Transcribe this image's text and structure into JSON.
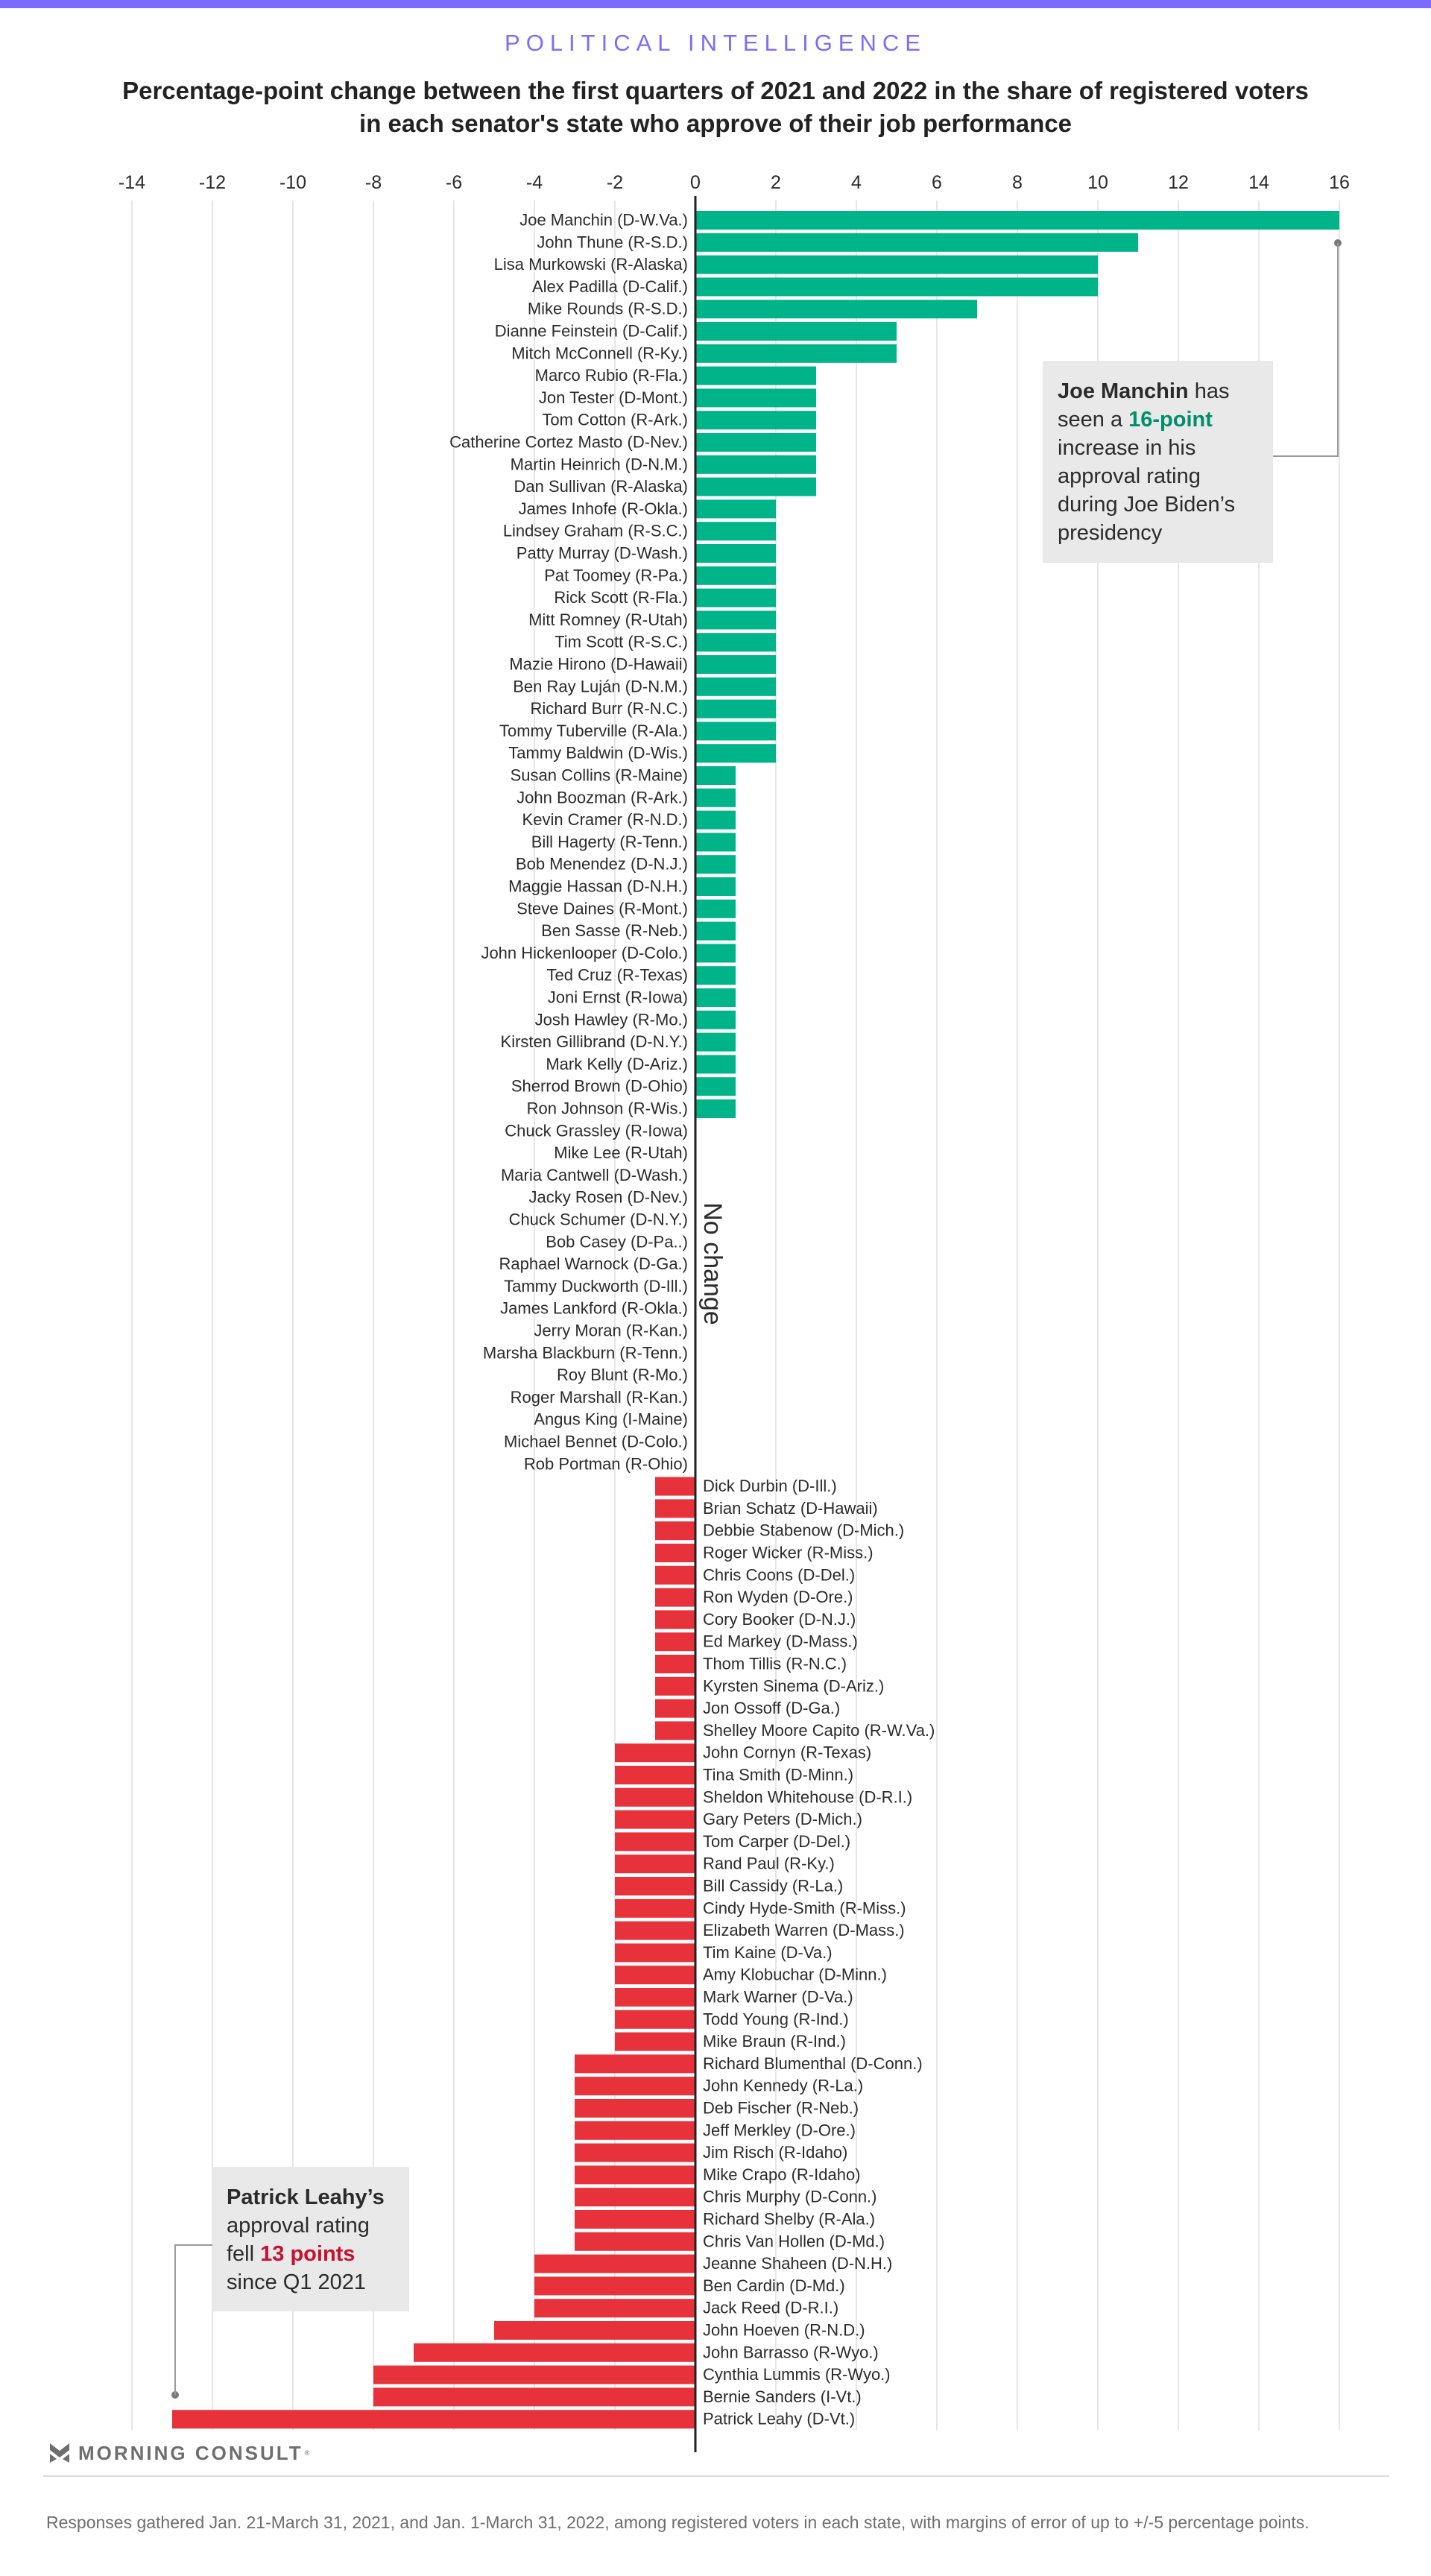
{
  "header": {
    "kicker": "POLITICAL INTELLIGENCE",
    "title": "Percentage-point change between the first quarters of 2021 and 2022 in the share of registered voters in each senator's state who approve of their job performance"
  },
  "colors": {
    "accent": "#7d6bff",
    "positive": "#00b48a",
    "negative": "#e8323b",
    "annotation_green": "#008f6b",
    "annotation_red": "#c8102e",
    "annotation_bg": "#e9e9e9"
  },
  "chart_data": {
    "type": "bar",
    "orientation": "horizontal",
    "title": "Percentage-point change between the first quarters of 2021 and 2022 in the share of registered voters in each senator's state who approve of their job performance",
    "xlabel": "",
    "ylabel": "",
    "xlim": [
      -14,
      16
    ],
    "xticks": [
      -14,
      -12,
      -10,
      -8,
      -6,
      -4,
      -2,
      0,
      2,
      4,
      6,
      8,
      10,
      12,
      14,
      16
    ],
    "xtick_labels": [
      "-14",
      "-12",
      "-10",
      "-8",
      "-6",
      "-4",
      "-2",
      "0",
      "2",
      "4",
      "6",
      "8",
      "10",
      "12",
      "14",
      "16"
    ],
    "axis_position": "top",
    "grid": true,
    "zero_label": "No change",
    "categories": [
      "Joe Manchin (D-W.Va.)",
      "John Thune (R-S.D.)",
      "Lisa Murkowski (R-Alaska)",
      "Alex Padilla (D-Calif.)",
      "Mike Rounds (R-S.D.)",
      "Dianne Feinstein (D-Calif.)",
      "Mitch McConnell (R-Ky.)",
      "Marco Rubio (R-Fla.)",
      "Jon Tester (D-Mont.)",
      "Tom Cotton (R-Ark.)",
      "Catherine Cortez Masto (D-Nev.)",
      "Martin Heinrich (D-N.M.)",
      "Dan Sullivan (R-Alaska)",
      "James Inhofe (R-Okla.)",
      "Lindsey Graham (R-S.C.)",
      "Patty Murray (D-Wash.)",
      "Pat Toomey (R-Pa.)",
      "Rick Scott (R-Fla.)",
      "Mitt Romney (R-Utah)",
      "Tim Scott (R-S.C.)",
      "Mazie Hirono (D-Hawaii)",
      "Ben Ray Luján (D-N.M.)",
      "Richard Burr (R-N.C.)",
      "Tommy Tuberville (R-Ala.)",
      "Tammy Baldwin (D-Wis.)",
      "Susan Collins (R-Maine)",
      "John Boozman (R-Ark.)",
      "Kevin Cramer (R-N.D.)",
      "Bill Hagerty (R-Tenn.)",
      "Bob Menendez (D-N.J.)",
      "Maggie Hassan (D-N.H.)",
      "Steve Daines (R-Mont.)",
      "Ben Sasse (R-Neb.)",
      "John Hickenlooper (D-Colo.)",
      "Ted Cruz (R-Texas)",
      "Joni Ernst (R-Iowa)",
      "Josh Hawley (R-Mo.)",
      "Kirsten Gillibrand (D-N.Y.)",
      "Mark Kelly (D-Ariz.)",
      "Sherrod Brown (D-Ohio)",
      "Ron Johnson (R-Wis.)",
      "Chuck Grassley (R-Iowa)",
      "Mike Lee (R-Utah)",
      "Maria Cantwell (D-Wash.)",
      "Jacky Rosen (D-Nev.)",
      "Chuck Schumer (D-N.Y.)",
      "Bob Casey (D-Pa..)",
      "Raphael Warnock (D-Ga.)",
      "Tammy Duckworth (D-Ill.)",
      "James Lankford (R-Okla.)",
      "Jerry Moran (R-Kan.)",
      "Marsha Blackburn (R-Tenn.)",
      "Roy Blunt (R-Mo.)",
      "Roger Marshall (R-Kan.)",
      "Angus King (I-Maine)",
      "Michael Bennet (D-Colo.)",
      "Rob Portman (R-Ohio)",
      "Dick Durbin (D-Ill.)",
      "Brian Schatz (D-Hawaii)",
      "Debbie Stabenow (D-Mich.)",
      "Roger Wicker (R-Miss.)",
      "Chris Coons (D-Del.)",
      "Ron Wyden (D-Ore.)",
      "Cory Booker (D-N.J.)",
      "Ed Markey (D-Mass.)",
      "Thom Tillis (R-N.C.)",
      "Kyrsten Sinema (D-Ariz.)",
      "Jon Ossoff (D-Ga.)",
      "Shelley Moore Capito (R-W.Va.)",
      "John Cornyn (R-Texas)",
      "Tina Smith (D-Minn.)",
      "Sheldon Whitehouse (D-R.I.)",
      "Gary Peters (D-Mich.)",
      "Tom Carper (D-Del.)",
      "Rand Paul (R-Ky.)",
      "Bill Cassidy (R-La.)",
      "Cindy Hyde-Smith (R-Miss.)",
      "Elizabeth Warren (D-Mass.)",
      "Tim Kaine (D-Va.)",
      "Amy Klobuchar (D-Minn.)",
      "Mark Warner (D-Va.)",
      "Todd Young (R-Ind.)",
      "Mike Braun (R-Ind.)",
      "Richard Blumenthal (D-Conn.)",
      "John Kennedy (R-La.)",
      "Deb Fischer (R-Neb.)",
      "Jeff Merkley (D-Ore.)",
      "Jim Risch (R-Idaho)",
      "Mike Crapo (R-Idaho)",
      "Chris Murphy (D-Conn.)",
      "Richard Shelby (R-Ala.)",
      "Chris Van Hollen (D-Md.)",
      "Jeanne Shaheen (D-N.H.)",
      "Ben Cardin (D-Md.)",
      "Jack Reed (D-R.I.)",
      "John Hoeven (R-N.D.)",
      "John Barrasso (R-Wyo.)",
      "Cynthia Lummis (R-Wyo.)",
      "Bernie Sanders (I-Vt.)",
      "Patrick Leahy (D-Vt.)"
    ],
    "values": [
      16,
      11,
      10,
      10,
      7,
      5,
      5,
      3,
      3,
      3,
      3,
      3,
      3,
      2,
      2,
      2,
      2,
      2,
      2,
      2,
      2,
      2,
      2,
      2,
      2,
      1,
      1,
      1,
      1,
      1,
      1,
      1,
      1,
      1,
      1,
      1,
      1,
      1,
      1,
      1,
      1,
      0,
      0,
      0,
      0,
      0,
      0,
      0,
      0,
      0,
      0,
      0,
      0,
      0,
      0,
      0,
      0,
      -1,
      -1,
      -1,
      -1,
      -1,
      -1,
      -1,
      -1,
      -1,
      -1,
      -1,
      -1,
      -2,
      -2,
      -2,
      -2,
      -2,
      -2,
      -2,
      -2,
      -2,
      -2,
      -2,
      -2,
      -2,
      -2,
      -3,
      -3,
      -3,
      -3,
      -3,
      -3,
      -3,
      -3,
      -3,
      -4,
      -4,
      -4,
      -5,
      -7,
      -8,
      -8,
      -13
    ],
    "annotations": [
      {
        "target": "Joe Manchin (D-W.Va.)",
        "parts": [
          {
            "text": "Joe Manchin",
            "style": "bold"
          },
          {
            "text": " has seen a ",
            "style": "normal"
          },
          {
            "text": "16-point",
            "style": "green"
          },
          {
            "text": " increase in his approval rating during Joe Biden’s presidency",
            "style": "normal"
          }
        ]
      },
      {
        "target": "Patrick Leahy (D-Vt.)",
        "parts": [
          {
            "text": "Patrick Leahy’s",
            "style": "bold"
          },
          {
            "text": " approval rating fell ",
            "style": "normal"
          },
          {
            "text": "13 points",
            "style": "red"
          },
          {
            "text": " since Q1 2021",
            "style": "normal"
          }
        ]
      }
    ]
  },
  "footer": {
    "logo_text": "MORNING CONSULT",
    "logo_reg": "®",
    "note": "Responses gathered Jan. 21-March 31, 2021, and Jan. 1-March 31, 2022, among registered voters in each state, with margins of error of up to +/-5 percentage points."
  }
}
